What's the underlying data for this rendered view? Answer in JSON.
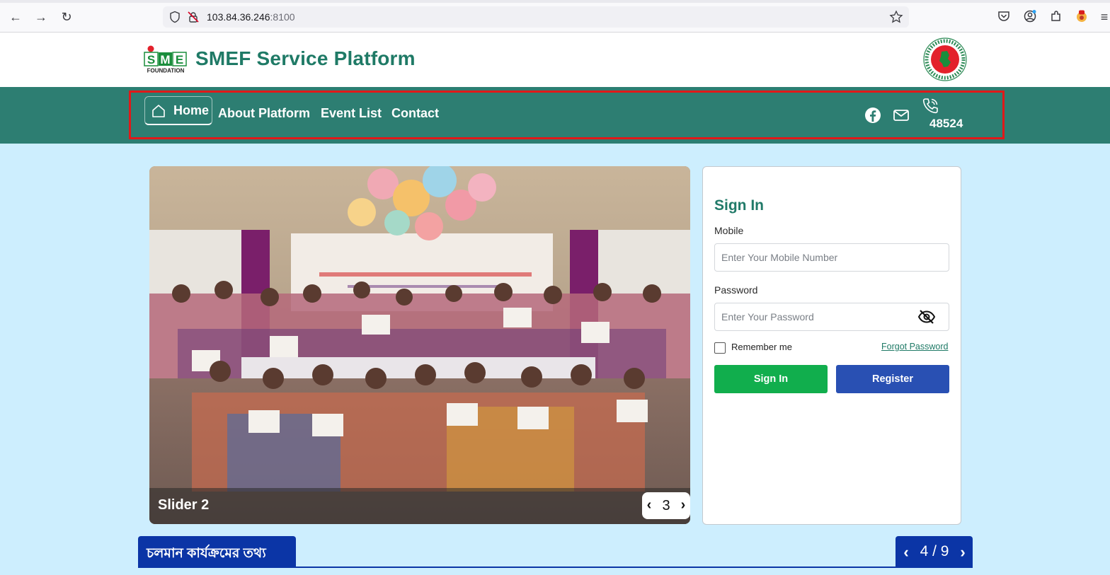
{
  "browser": {
    "url_host": "103.84.36.246",
    "url_port": ":8100"
  },
  "header": {
    "site_title": "SMEF Service Platform",
    "logo_text_top": "SME",
    "logo_text_bottom": "FOUNDATION"
  },
  "nav": {
    "home": "Home",
    "about": "About Platform",
    "events": "Event List",
    "contact": "Contact",
    "phone": "48524"
  },
  "slider": {
    "caption": "Slider 2",
    "current": "3",
    "prev": "‹",
    "next": "›"
  },
  "signin": {
    "title": "Sign In",
    "mobile_label": "Mobile",
    "mobile_placeholder": "Enter Your Mobile Number",
    "password_label": "Password",
    "password_placeholder": "Enter Your Password",
    "remember": "Remember me",
    "forgot": "Forgot Password",
    "signin_button": "Sign In",
    "register_button": "Register"
  },
  "activity": {
    "title": "চলমান কার্যক্রমের তথ্য",
    "pager": "4 / 9",
    "prev": "‹",
    "next": "›"
  },
  "colors": {
    "brand_teal": "#2d7e72",
    "title_green": "#1f7a66",
    "signin_green": "#11ae4d",
    "register_blue": "#2950b3",
    "activity_blue": "#0b35a6",
    "page_bg": "#cdeefe"
  }
}
